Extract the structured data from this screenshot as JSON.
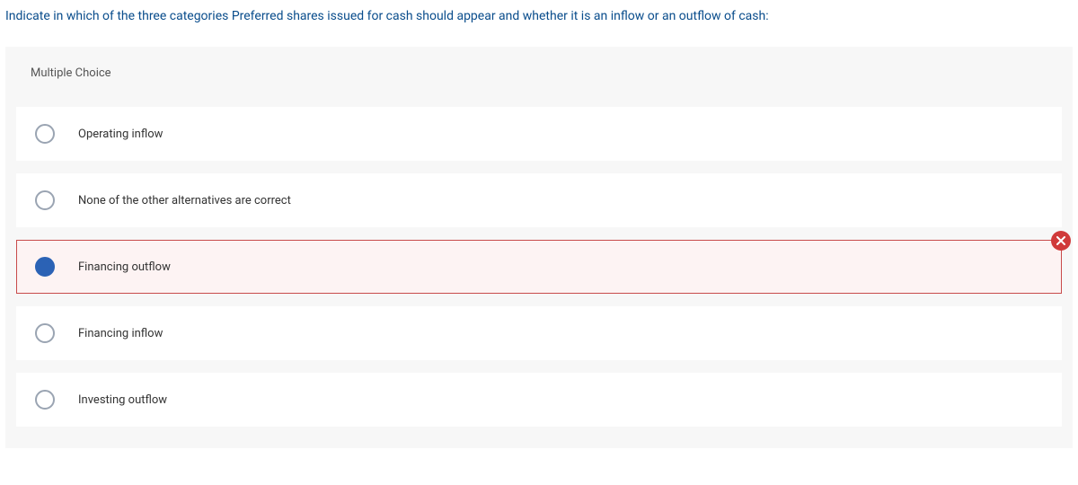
{
  "question": {
    "prompt": "Indicate in which of the three categories Preferred shares issued for cash should appear and whether it is an inflow or an outflow of cash:"
  },
  "quiz": {
    "type_label": "Multiple Choice",
    "options": [
      {
        "label": "Operating inflow"
      },
      {
        "label": "None of the other alternatives are correct"
      },
      {
        "label": "Financing outflow"
      },
      {
        "label": "Financing inflow"
      },
      {
        "label": "Investing outflow"
      }
    ]
  }
}
